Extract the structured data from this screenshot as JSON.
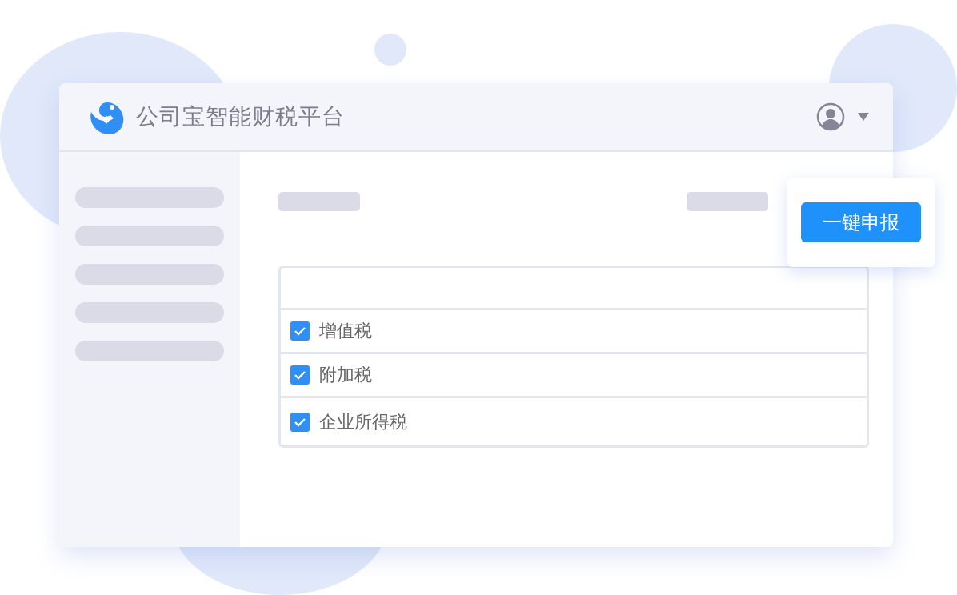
{
  "header": {
    "title": "公司宝智能财税平台"
  },
  "tax_list": {
    "items": [
      {
        "label": "增值税",
        "checked": true
      },
      {
        "label": "附加税",
        "checked": true
      },
      {
        "label": "企业所得税",
        "checked": true
      }
    ]
  },
  "popover": {
    "button": "一键申报"
  }
}
